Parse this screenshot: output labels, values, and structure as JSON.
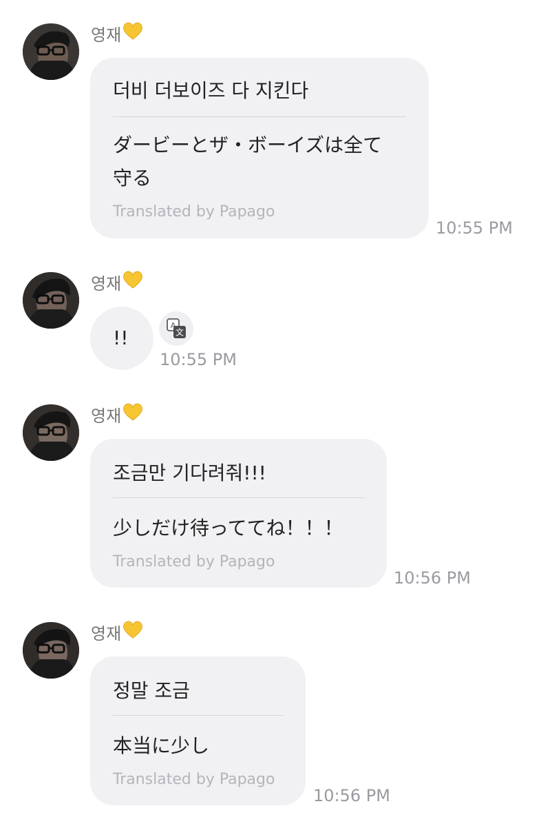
{
  "messages": [
    {
      "sender": "영재",
      "original": "더비 더보이즈 다 지킨다",
      "translation_line1": "ダービーとザ・ボーイズは全て",
      "translation_line2": "守る",
      "credit": "Translated by Papago",
      "time": "10:55 PM"
    },
    {
      "sender": "영재",
      "original": "!!",
      "time": "10:55 PM",
      "translate_icon": "translate-icon"
    },
    {
      "sender": "영재",
      "original": "조금만 기다려줘!!!",
      "translation_line1": "少しだけ待っててね！！！",
      "credit": "Translated by Papago",
      "time": "10:56 PM"
    },
    {
      "sender": "영재",
      "original": "정말 조금",
      "translation_line1": "本当に少し",
      "credit": "Translated by Papago",
      "time": "10:56 PM"
    }
  ],
  "icons": {
    "heart": "yellow-heart-icon",
    "avatar": "profile-photo"
  },
  "colors": {
    "bubble": "#f1f1f4",
    "heart": "#f7c531",
    "text": "#222222",
    "timestamp": "#9a9aa0"
  }
}
